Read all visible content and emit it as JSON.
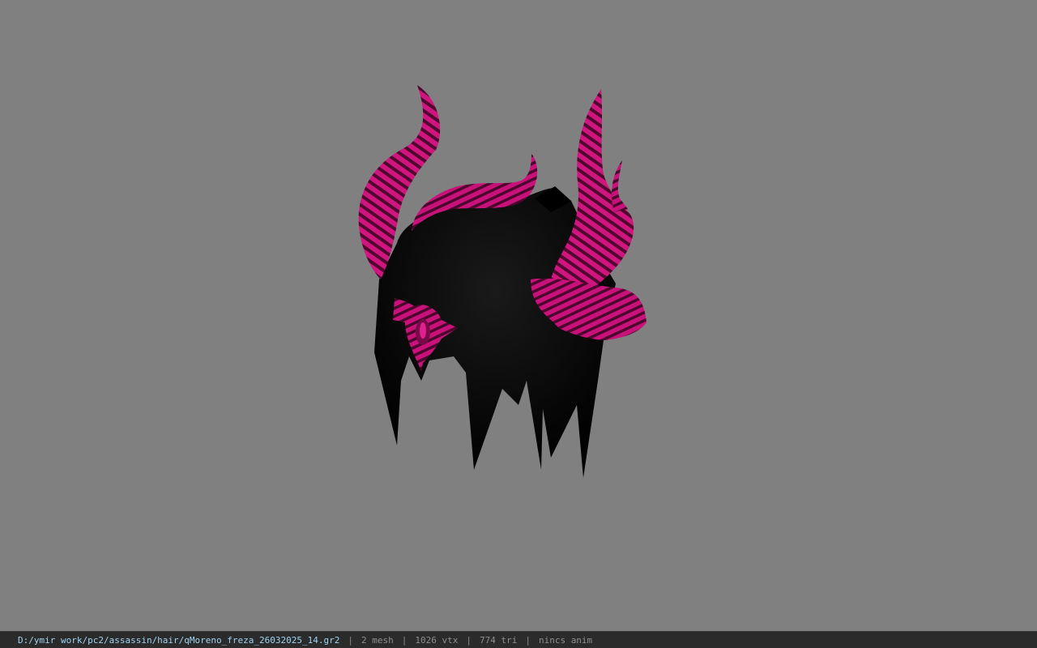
{
  "viewer": {
    "background_color": "#808080",
    "model": {
      "hair_color": "#050505",
      "horn_color": "#d0157e",
      "horn_stripe_color": "#3a0521"
    }
  },
  "status_bar": {
    "file_path": "D:/ymir work/pc2/assassin/hair/qMoreno_freza_26032025_14.gr2",
    "separator": "|",
    "mesh_count": "2 mesh",
    "vertex_count": "1026 vtx",
    "triangle_count": "774 tri",
    "animation_status": "nincs anim"
  }
}
